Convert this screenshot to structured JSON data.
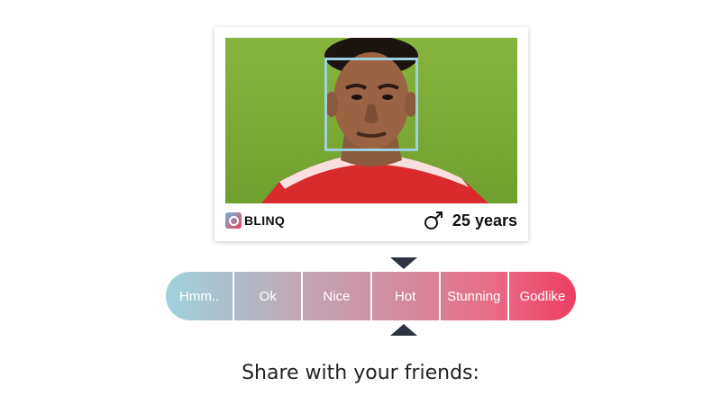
{
  "card": {
    "photo_icon": "portrait-photo",
    "face_box_color": "#9ed0df",
    "brand_name": "BLINQ",
    "brand_icon": "blinq-logo-icon",
    "gender_icon": "male-symbol-icon",
    "gender_symbol": "♂",
    "age_text": "25 years"
  },
  "rating": {
    "options": [
      "Hmm..",
      "Ok",
      "Nice",
      "Hot",
      "Stunning",
      "Godlike"
    ],
    "selected": "Hot",
    "marker_color": "#2d3340",
    "gradient_start": "#9fd3dc",
    "gradient_end": "#ee3e62"
  },
  "share": {
    "label": "Share with your friends:"
  }
}
